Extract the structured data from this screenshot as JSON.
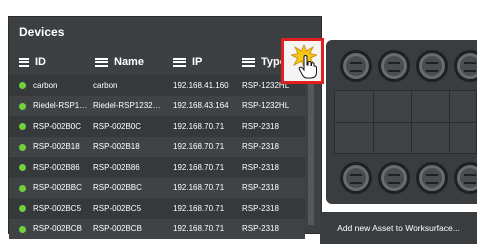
{
  "panel": {
    "title": "Devices",
    "columns": [
      "ID",
      "Name",
      "IP",
      "Type"
    ]
  },
  "devices": [
    {
      "id": "carbon",
      "name": "carbon",
      "ip": "192.168.41.160",
      "type": "RSP-1232HL"
    },
    {
      "id": "Riedel-RSP123...",
      "name": "Riedel-RSP1232HL-0...",
      "ip": "192.168.43.164",
      "type": "RSP-1232HL"
    },
    {
      "id": "RSP-002B0C",
      "name": "RSP-002B0C",
      "ip": "192.168.70.71",
      "type": "RSP-2318"
    },
    {
      "id": "RSP-002B18",
      "name": "RSP-002B18",
      "ip": "192.168.70.71",
      "type": "RSP-2318"
    },
    {
      "id": "RSP-002B86",
      "name": "RSP-002B86",
      "ip": "192.168.70.71",
      "type": "RSP-2318"
    },
    {
      "id": "RSP-002BBC",
      "name": "RSP-002BBC",
      "ip": "192.168.70.71",
      "type": "RSP-2318"
    },
    {
      "id": "RSP-002BC5",
      "name": "RSP-002BC5",
      "ip": "192.168.70.71",
      "type": "RSP-2318"
    },
    {
      "id": "RSP-002BCB",
      "name": "RSP-002BCB",
      "ip": "192.168.70.71",
      "type": "RSP-2318"
    }
  ],
  "status_color": "#6fd23a",
  "right_panel": {
    "add_asset_label": "Add new Asset to Worksurface..."
  },
  "icons": {
    "callout": "starburst-click-icon",
    "cursor": "hand-pointer-icon"
  },
  "accent": "#e02020"
}
